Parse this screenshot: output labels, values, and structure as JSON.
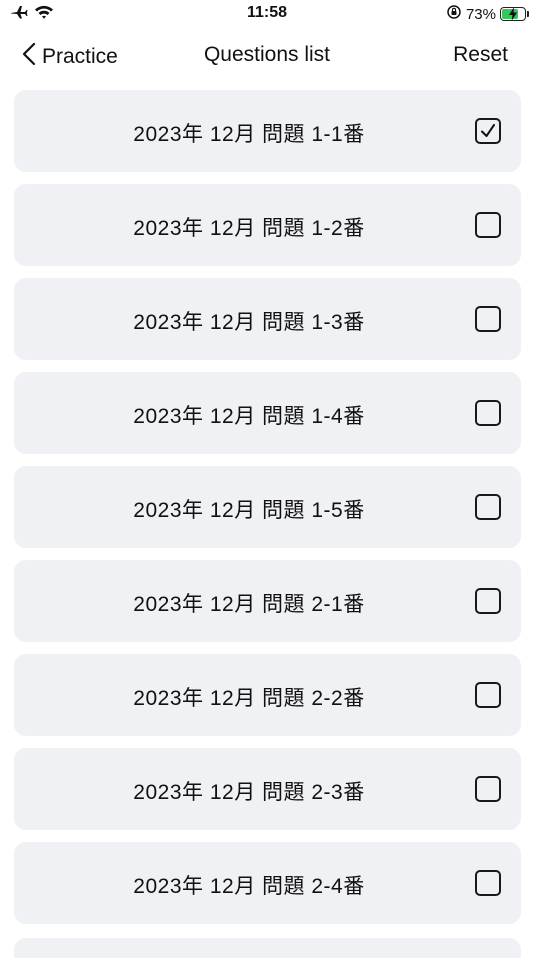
{
  "status_bar": {
    "time": "11:58",
    "battery_percent": "73%",
    "battery_level": 0.73,
    "icons": [
      "airplane-icon",
      "wifi-icon",
      "orientation-lock-icon",
      "battery-charging-icon"
    ]
  },
  "nav": {
    "back_label": "Practice",
    "title": "Questions list",
    "reset_label": "Reset"
  },
  "items": [
    {
      "label": "2023年 12月 問題 1-1番",
      "checked": true
    },
    {
      "label": "2023年 12月 問題 1-2番",
      "checked": false
    },
    {
      "label": "2023年 12月 問題 1-3番",
      "checked": false
    },
    {
      "label": "2023年 12月 問題 1-4番",
      "checked": false
    },
    {
      "label": "2023年 12月 問題 1-5番",
      "checked": false
    },
    {
      "label": "2023年 12月 問題 2-1番",
      "checked": false
    },
    {
      "label": "2023年 12月 問題 2-2番",
      "checked": false
    },
    {
      "label": "2023年 12月 問題 2-3番",
      "checked": false
    },
    {
      "label": "2023年 12月 問題 2-4番",
      "checked": false
    }
  ],
  "colors": {
    "row_background": "#f0f1f5",
    "battery_green": "#34c759",
    "text": "#111111"
  }
}
